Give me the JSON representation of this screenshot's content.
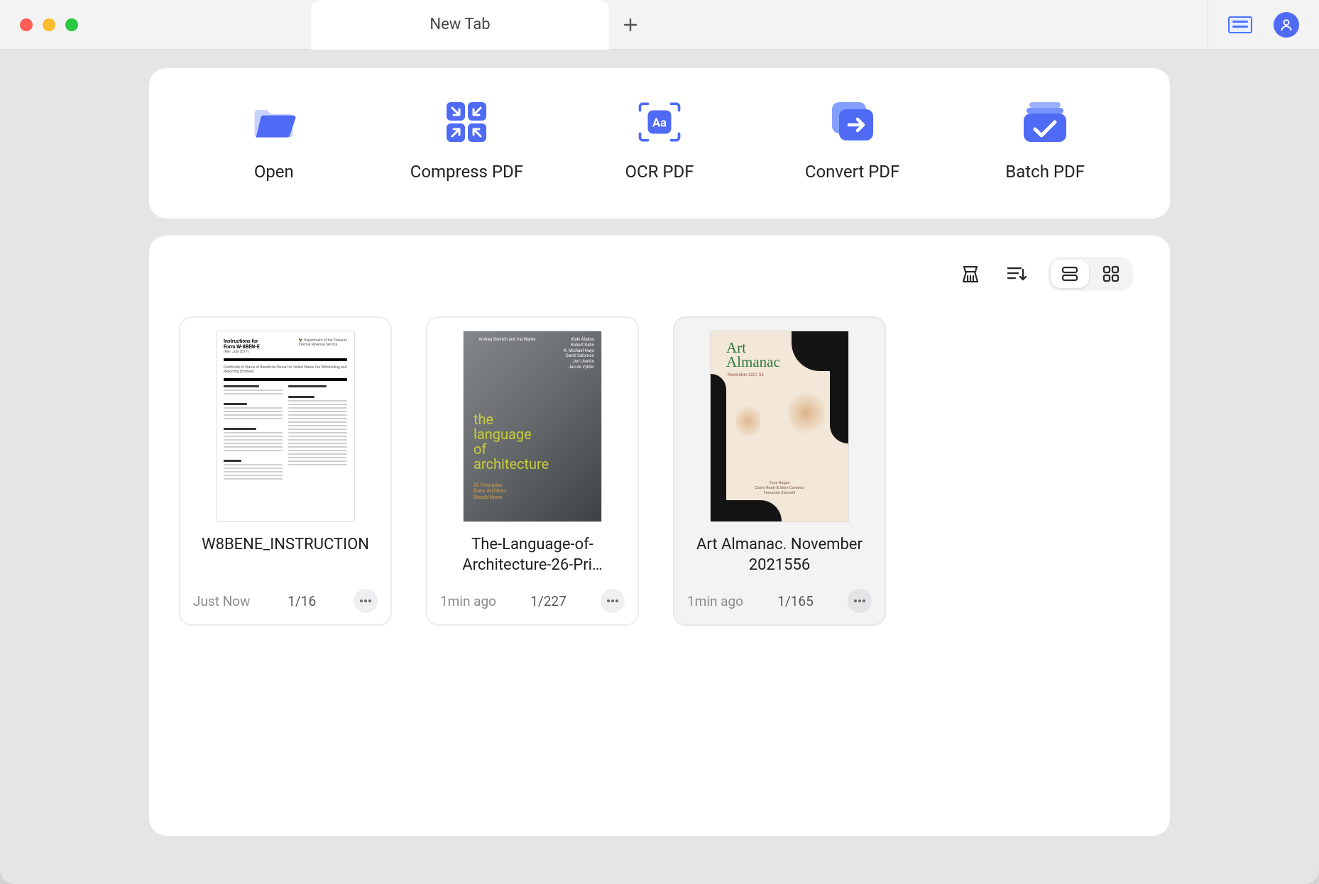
{
  "tab": {
    "title": "New Tab"
  },
  "actions": [
    {
      "id": "open",
      "label": "Open"
    },
    {
      "id": "compress",
      "label": "Compress PDF"
    },
    {
      "id": "ocr",
      "label": "OCR PDF"
    },
    {
      "id": "convert",
      "label": "Convert PDF"
    },
    {
      "id": "batch",
      "label": "Batch PDF"
    }
  ],
  "view": {
    "mode": "list"
  },
  "recent": [
    {
      "title": "W8BENE_INSTRUCTION",
      "time": "Just Now",
      "pages": "1/16",
      "thumb_heading": "Instructions for\nForm W-8BEN-E",
      "thumb_sub": "(Rev. July 2017)"
    },
    {
      "title": "The-Language-of-Architecture-26-Pri…",
      "time": "1min ago",
      "pages": "1/227",
      "thumb_title_1": "the",
      "thumb_title_2": "language",
      "thumb_title_3": "of",
      "thumb_title_4": "architecture",
      "thumb_authors_top": "Andrea Simitch and Val Warke"
    },
    {
      "title": "Art Almanac. November 2021556",
      "time": "1min ago",
      "pages": "1/165",
      "thumb_t1": "Art\nAlmanac",
      "thumb_t2": "November 2021 $6"
    }
  ]
}
